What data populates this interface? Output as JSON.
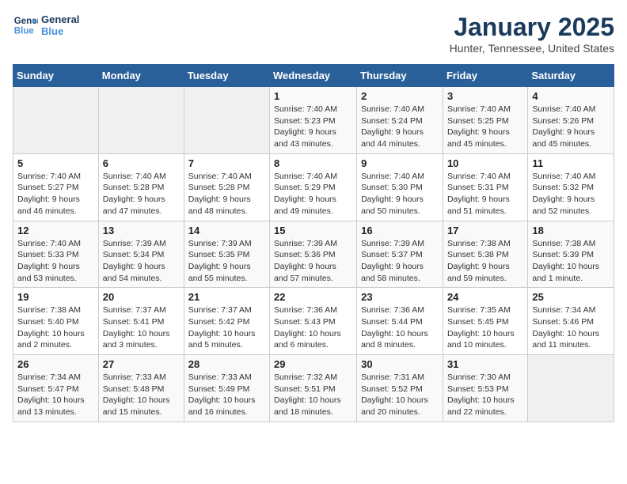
{
  "header": {
    "logo_line1": "General",
    "logo_line2": "Blue",
    "title": "January 2025",
    "subtitle": "Hunter, Tennessee, United States"
  },
  "days_of_week": [
    "Sunday",
    "Monday",
    "Tuesday",
    "Wednesday",
    "Thursday",
    "Friday",
    "Saturday"
  ],
  "weeks": [
    [
      {
        "num": "",
        "info": ""
      },
      {
        "num": "",
        "info": ""
      },
      {
        "num": "",
        "info": ""
      },
      {
        "num": "1",
        "info": "Sunrise: 7:40 AM\nSunset: 5:23 PM\nDaylight: 9 hours\nand 43 minutes."
      },
      {
        "num": "2",
        "info": "Sunrise: 7:40 AM\nSunset: 5:24 PM\nDaylight: 9 hours\nand 44 minutes."
      },
      {
        "num": "3",
        "info": "Sunrise: 7:40 AM\nSunset: 5:25 PM\nDaylight: 9 hours\nand 45 minutes."
      },
      {
        "num": "4",
        "info": "Sunrise: 7:40 AM\nSunset: 5:26 PM\nDaylight: 9 hours\nand 45 minutes."
      }
    ],
    [
      {
        "num": "5",
        "info": "Sunrise: 7:40 AM\nSunset: 5:27 PM\nDaylight: 9 hours\nand 46 minutes."
      },
      {
        "num": "6",
        "info": "Sunrise: 7:40 AM\nSunset: 5:28 PM\nDaylight: 9 hours\nand 47 minutes."
      },
      {
        "num": "7",
        "info": "Sunrise: 7:40 AM\nSunset: 5:28 PM\nDaylight: 9 hours\nand 48 minutes."
      },
      {
        "num": "8",
        "info": "Sunrise: 7:40 AM\nSunset: 5:29 PM\nDaylight: 9 hours\nand 49 minutes."
      },
      {
        "num": "9",
        "info": "Sunrise: 7:40 AM\nSunset: 5:30 PM\nDaylight: 9 hours\nand 50 minutes."
      },
      {
        "num": "10",
        "info": "Sunrise: 7:40 AM\nSunset: 5:31 PM\nDaylight: 9 hours\nand 51 minutes."
      },
      {
        "num": "11",
        "info": "Sunrise: 7:40 AM\nSunset: 5:32 PM\nDaylight: 9 hours\nand 52 minutes."
      }
    ],
    [
      {
        "num": "12",
        "info": "Sunrise: 7:40 AM\nSunset: 5:33 PM\nDaylight: 9 hours\nand 53 minutes."
      },
      {
        "num": "13",
        "info": "Sunrise: 7:39 AM\nSunset: 5:34 PM\nDaylight: 9 hours\nand 54 minutes."
      },
      {
        "num": "14",
        "info": "Sunrise: 7:39 AM\nSunset: 5:35 PM\nDaylight: 9 hours\nand 55 minutes."
      },
      {
        "num": "15",
        "info": "Sunrise: 7:39 AM\nSunset: 5:36 PM\nDaylight: 9 hours\nand 57 minutes."
      },
      {
        "num": "16",
        "info": "Sunrise: 7:39 AM\nSunset: 5:37 PM\nDaylight: 9 hours\nand 58 minutes."
      },
      {
        "num": "17",
        "info": "Sunrise: 7:38 AM\nSunset: 5:38 PM\nDaylight: 9 hours\nand 59 minutes."
      },
      {
        "num": "18",
        "info": "Sunrise: 7:38 AM\nSunset: 5:39 PM\nDaylight: 10 hours\nand 1 minute."
      }
    ],
    [
      {
        "num": "19",
        "info": "Sunrise: 7:38 AM\nSunset: 5:40 PM\nDaylight: 10 hours\nand 2 minutes."
      },
      {
        "num": "20",
        "info": "Sunrise: 7:37 AM\nSunset: 5:41 PM\nDaylight: 10 hours\nand 3 minutes."
      },
      {
        "num": "21",
        "info": "Sunrise: 7:37 AM\nSunset: 5:42 PM\nDaylight: 10 hours\nand 5 minutes."
      },
      {
        "num": "22",
        "info": "Sunrise: 7:36 AM\nSunset: 5:43 PM\nDaylight: 10 hours\nand 6 minutes."
      },
      {
        "num": "23",
        "info": "Sunrise: 7:36 AM\nSunset: 5:44 PM\nDaylight: 10 hours\nand 8 minutes."
      },
      {
        "num": "24",
        "info": "Sunrise: 7:35 AM\nSunset: 5:45 PM\nDaylight: 10 hours\nand 10 minutes."
      },
      {
        "num": "25",
        "info": "Sunrise: 7:34 AM\nSunset: 5:46 PM\nDaylight: 10 hours\nand 11 minutes."
      }
    ],
    [
      {
        "num": "26",
        "info": "Sunrise: 7:34 AM\nSunset: 5:47 PM\nDaylight: 10 hours\nand 13 minutes."
      },
      {
        "num": "27",
        "info": "Sunrise: 7:33 AM\nSunset: 5:48 PM\nDaylight: 10 hours\nand 15 minutes."
      },
      {
        "num": "28",
        "info": "Sunrise: 7:33 AM\nSunset: 5:49 PM\nDaylight: 10 hours\nand 16 minutes."
      },
      {
        "num": "29",
        "info": "Sunrise: 7:32 AM\nSunset: 5:51 PM\nDaylight: 10 hours\nand 18 minutes."
      },
      {
        "num": "30",
        "info": "Sunrise: 7:31 AM\nSunset: 5:52 PM\nDaylight: 10 hours\nand 20 minutes."
      },
      {
        "num": "31",
        "info": "Sunrise: 7:30 AM\nSunset: 5:53 PM\nDaylight: 10 hours\nand 22 minutes."
      },
      {
        "num": "",
        "info": ""
      }
    ]
  ]
}
